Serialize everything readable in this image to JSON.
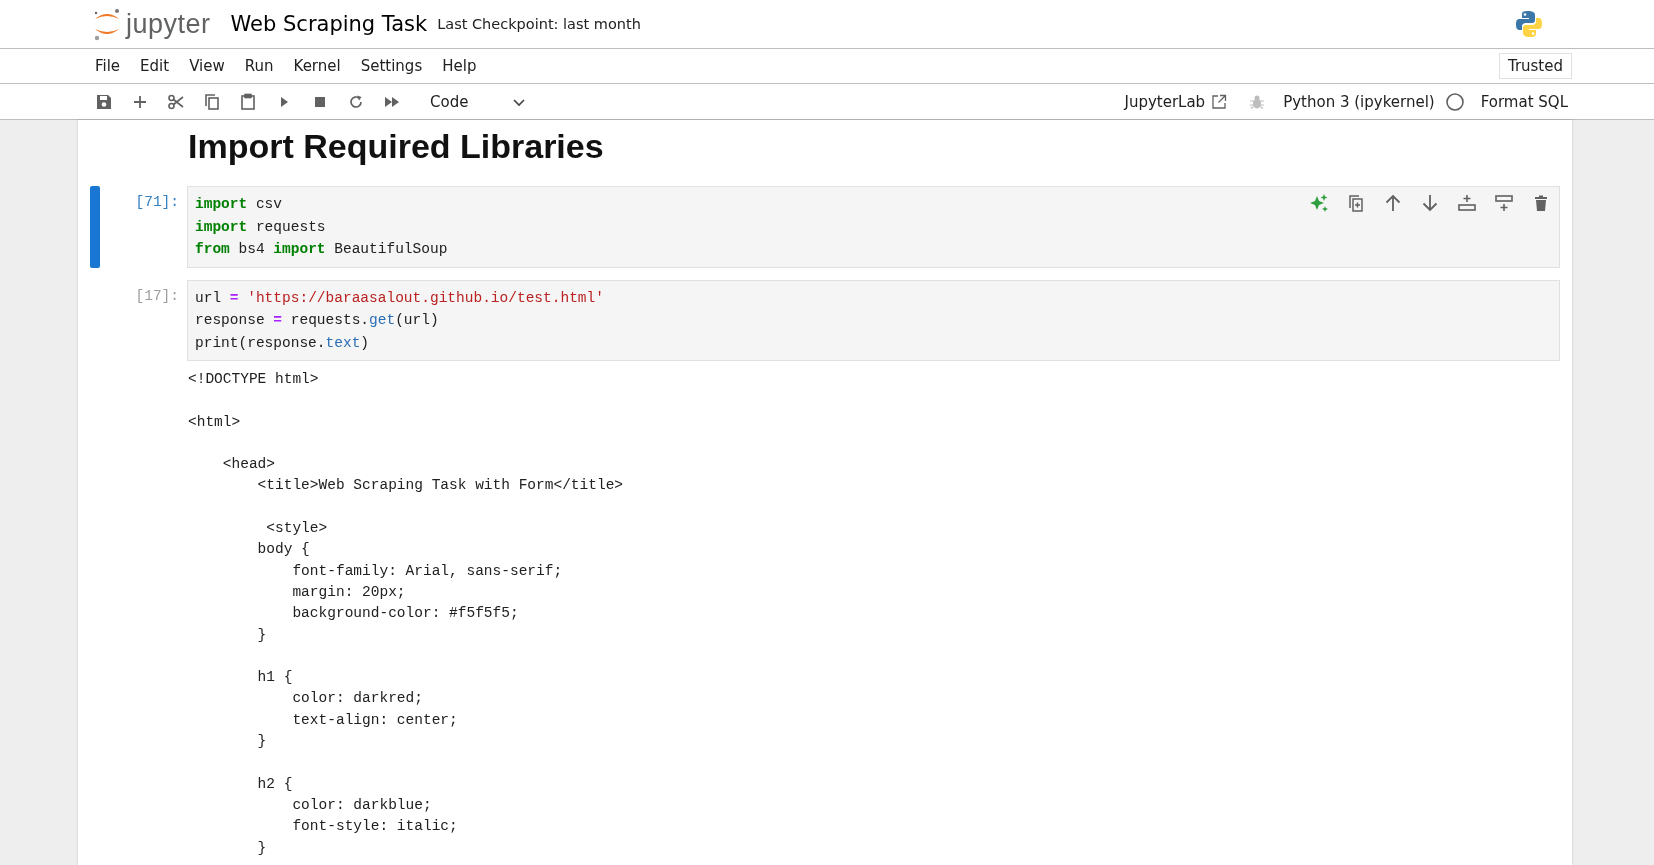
{
  "header": {
    "logo_text": "jupyter",
    "notebook_title": "Web Scraping Task",
    "checkpoint": "Last Checkpoint: last month"
  },
  "menu": [
    "File",
    "Edit",
    "View",
    "Run",
    "Kernel",
    "Settings",
    "Help"
  ],
  "trusted": "Trusted",
  "toolbar": {
    "cell_type": "Code",
    "launcher": "JupyterLab",
    "kernel": "Python 3 (ipykernel)",
    "format": "Format SQL"
  },
  "heading": "Import Required Libraries",
  "cells": [
    {
      "prompt": "[71]:",
      "selected": true,
      "lines": [
        [
          {
            "t": "import",
            "kind": "kw"
          },
          {
            "t": " csv",
            "kind": "name"
          }
        ],
        [
          {
            "t": "import",
            "kind": "kw"
          },
          {
            "t": " requests",
            "kind": "name"
          }
        ],
        [
          {
            "t": "from",
            "kind": "kw"
          },
          {
            "t": " bs4 ",
            "kind": "name"
          },
          {
            "t": "import",
            "kind": "kw"
          },
          {
            "t": " BeautifulSoup",
            "kind": "name"
          }
        ]
      ]
    },
    {
      "prompt": "[17]:",
      "selected": false,
      "lines": [
        [
          {
            "t": "url ",
            "kind": "name"
          },
          {
            "t": "=",
            "kind": "op"
          },
          {
            "t": " 'https://baraasalout.github.io/test.html'",
            "kind": "str"
          }
        ],
        [
          {
            "t": "response ",
            "kind": "name"
          },
          {
            "t": "=",
            "kind": "op"
          },
          {
            "t": " requests.",
            "kind": "name"
          },
          {
            "t": "get",
            "kind": "attr"
          },
          {
            "t": "(url)",
            "kind": "name"
          }
        ],
        [
          {
            "t": "print(response.",
            "kind": "name"
          },
          {
            "t": "text",
            "kind": "attr"
          },
          {
            "t": ")",
            "kind": "name"
          }
        ]
      ],
      "output": "<!DOCTYPE html>\n\n<html>\n\n    <head>\n        <title>Web Scraping Task with Form</title>\n\n         <style>\n        body {\n            font-family: Arial, sans-serif;\n            margin: 20px;\n            background-color: #f5f5f5;\n        }\n\n        h1 {\n            color: darkred;\n            text-align: center;\n        }\n\n        h2 {\n            color: darkblue;\n            font-style: italic;\n        }"
    }
  ]
}
